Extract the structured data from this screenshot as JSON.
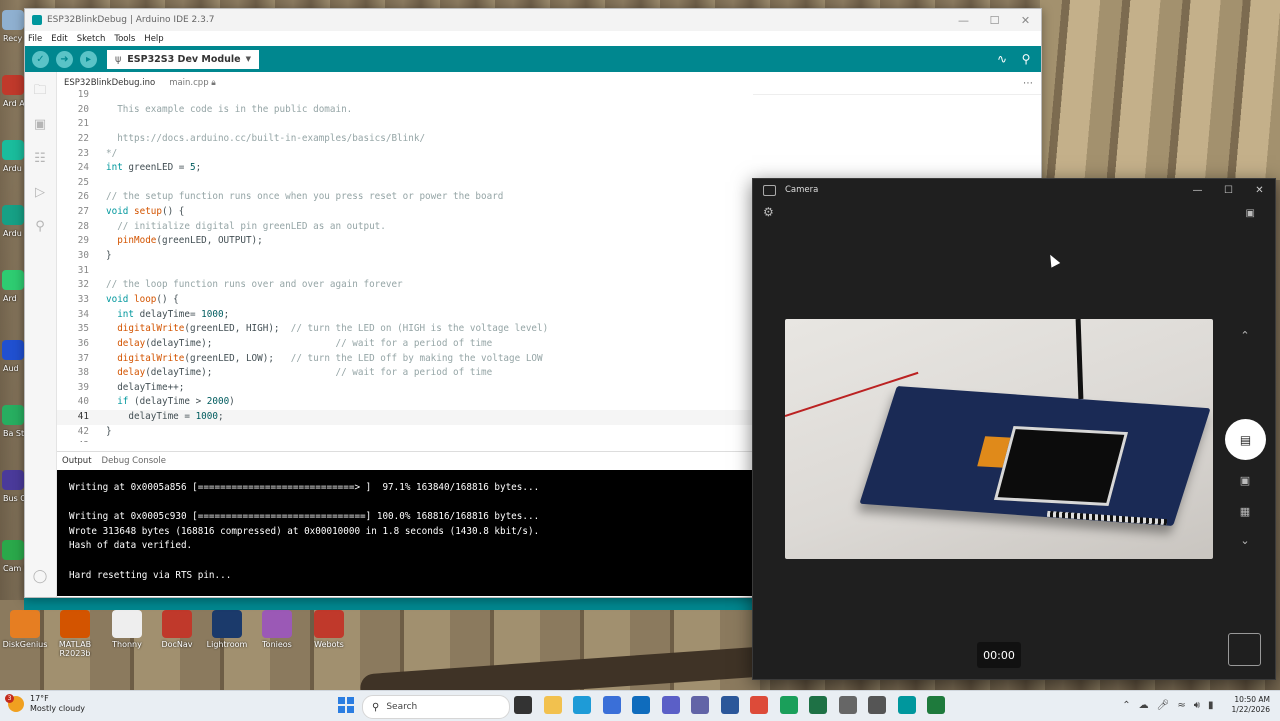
{
  "desktop": {
    "left_icons": [
      {
        "label": "Recy",
        "color": "#8fb0d0"
      },
      {
        "label": "Ard Ac",
        "color": "#c0392b"
      },
      {
        "label": "Ardu",
        "color": "#1abc9c"
      },
      {
        "label": "Ardu",
        "color": "#16a085"
      },
      {
        "label": "Ard",
        "color": "#2ecc71"
      },
      {
        "label": "Aud",
        "color": "#2050d0"
      },
      {
        "label": "Ba Stu",
        "color": "#27ae60"
      },
      {
        "label": "Bus Co",
        "color": "#4a3a9a"
      },
      {
        "label": "Cam Stu",
        "color": "#2aa84a"
      }
    ],
    "bottom_icons": [
      {
        "label": "DiskGenius",
        "color": "#e67e22"
      },
      {
        "label": "MATLAB R2023b",
        "color": "#d35400"
      },
      {
        "label": "Thonny",
        "color": "#eeeeee"
      },
      {
        "label": "DocNav",
        "color": "#c0392b"
      },
      {
        "label": "Lightroom",
        "color": "#1b3a6b"
      },
      {
        "label": "Tonieos",
        "color": "#9b59b6"
      },
      {
        "label": "Webots",
        "color": "#c0392b"
      }
    ]
  },
  "ide": {
    "title": "ESP32BlinkDebug | Arduino IDE 2.3.7",
    "menu": [
      "File",
      "Edit",
      "Sketch",
      "Tools",
      "Help"
    ],
    "board": "ESP32S3 Dev Module",
    "tabs": [
      {
        "label": "ESP32BlinkDebug.ino",
        "active": true
      },
      {
        "label": "main.cpp",
        "active": false
      }
    ],
    "code_lines": [
      {
        "n": "19",
        "parts": []
      },
      {
        "n": "20",
        "parts": [
          {
            "t": "  This example code is in the public domain.",
            "c": "c-comment"
          }
        ]
      },
      {
        "n": "21",
        "parts": []
      },
      {
        "n": "22",
        "parts": [
          {
            "t": "  https://docs.arduino.cc/built-in-examples/basics/Blink/",
            "c": "c-comment"
          }
        ]
      },
      {
        "n": "23",
        "parts": [
          {
            "t": "*/",
            "c": "c-comment"
          }
        ]
      },
      {
        "n": "24",
        "parts": [
          {
            "t": "int",
            "c": "c-kw"
          },
          {
            "t": " greenLED = ",
            "c": "c-plain"
          },
          {
            "t": "5",
            "c": "c-num"
          },
          {
            "t": ";",
            "c": "c-plain"
          }
        ]
      },
      {
        "n": "25",
        "parts": []
      },
      {
        "n": "26",
        "parts": [
          {
            "t": "// the setup function runs once when you press reset or power the board",
            "c": "c-comment"
          }
        ]
      },
      {
        "n": "27",
        "parts": [
          {
            "t": "void",
            "c": "c-kw"
          },
          {
            "t": " ",
            "c": "c-plain"
          },
          {
            "t": "setup",
            "c": "c-fn"
          },
          {
            "t": "() {",
            "c": "c-plain"
          }
        ]
      },
      {
        "n": "28",
        "parts": [
          {
            "t": "  // initialize digital pin greenLED as an output.",
            "c": "c-comment"
          }
        ]
      },
      {
        "n": "29",
        "parts": [
          {
            "t": "  ",
            "c": "c-plain"
          },
          {
            "t": "pinMode",
            "c": "c-fn"
          },
          {
            "t": "(greenLED, OUTPUT);",
            "c": "c-plain"
          }
        ]
      },
      {
        "n": "30",
        "parts": [
          {
            "t": "}",
            "c": "c-plain"
          }
        ]
      },
      {
        "n": "31",
        "parts": []
      },
      {
        "n": "32",
        "parts": [
          {
            "t": "// the loop function runs over and over again forever",
            "c": "c-comment"
          }
        ]
      },
      {
        "n": "33",
        "parts": [
          {
            "t": "void",
            "c": "c-kw"
          },
          {
            "t": " ",
            "c": "c-plain"
          },
          {
            "t": "loop",
            "c": "c-fn"
          },
          {
            "t": "() {",
            "c": "c-plain"
          }
        ]
      },
      {
        "n": "34",
        "parts": [
          {
            "t": "  ",
            "c": "c-plain"
          },
          {
            "t": "int",
            "c": "c-kw"
          },
          {
            "t": " delayTime= ",
            "c": "c-plain"
          },
          {
            "t": "1000",
            "c": "c-num"
          },
          {
            "t": ";",
            "c": "c-plain"
          }
        ]
      },
      {
        "n": "35",
        "parts": [
          {
            "t": "  ",
            "c": "c-plain"
          },
          {
            "t": "digitalWrite",
            "c": "c-fn"
          },
          {
            "t": "(greenLED, HIGH);  ",
            "c": "c-plain"
          },
          {
            "t": "// turn the LED on (HIGH is the voltage level)",
            "c": "c-comment"
          }
        ]
      },
      {
        "n": "36",
        "parts": [
          {
            "t": "  ",
            "c": "c-plain"
          },
          {
            "t": "delay",
            "c": "c-fn"
          },
          {
            "t": "(delayTime);                      ",
            "c": "c-plain"
          },
          {
            "t": "// wait for a period of time",
            "c": "c-comment"
          }
        ]
      },
      {
        "n": "37",
        "parts": [
          {
            "t": "  ",
            "c": "c-plain"
          },
          {
            "t": "digitalWrite",
            "c": "c-fn"
          },
          {
            "t": "(greenLED, LOW);   ",
            "c": "c-plain"
          },
          {
            "t": "// turn the LED off by making the voltage LOW",
            "c": "c-comment"
          }
        ]
      },
      {
        "n": "38",
        "parts": [
          {
            "t": "  ",
            "c": "c-plain"
          },
          {
            "t": "delay",
            "c": "c-fn"
          },
          {
            "t": "(delayTime);                      ",
            "c": "c-plain"
          },
          {
            "t": "// wait for a period of time",
            "c": "c-comment"
          }
        ]
      },
      {
        "n": "39",
        "parts": [
          {
            "t": "  delayTime++;",
            "c": "c-plain"
          }
        ]
      },
      {
        "n": "40",
        "parts": [
          {
            "t": "  ",
            "c": "c-plain"
          },
          {
            "t": "if",
            "c": "c-kw"
          },
          {
            "t": " (delayTime > ",
            "c": "c-plain"
          },
          {
            "t": "2000",
            "c": "c-num"
          },
          {
            "t": ")",
            "c": "c-plain"
          }
        ]
      },
      {
        "n": "41",
        "parts": [
          {
            "t": "    delayTime = ",
            "c": "c-plain"
          },
          {
            "t": "1000",
            "c": "c-num"
          },
          {
            "t": ";",
            "c": "c-plain"
          }
        ],
        "active": true
      },
      {
        "n": "42",
        "parts": [
          {
            "t": "}",
            "c": "c-plain"
          }
        ]
      },
      {
        "n": "43",
        "parts": []
      }
    ],
    "panel_tabs": [
      "Output",
      "Debug Console"
    ],
    "output_lines": [
      "Writing at 0x0005a856 [============================> ]  97.1% 163840/168816 bytes...",
      "",
      "Writing at 0x0005c930 [==============================] 100.0% 168816/168816 bytes...",
      "Wrote 313648 bytes (168816 compressed) at 0x00010000 in 1.8 seconds (1430.8 kbit/s).",
      "Hash of data verified.",
      "",
      "Hard resetting via RTS pin..."
    ]
  },
  "camera": {
    "title": "Camera",
    "timer": "00:00"
  },
  "taskbar": {
    "weather_temp": "17°F",
    "weather_desc": "Mostly cloudy",
    "weather_badge": "3",
    "search_label": "Search",
    "time": "10:50 AM",
    "date": "1/22/2026",
    "apps": [
      {
        "name": "task-view",
        "color": "#333333"
      },
      {
        "name": "file-explorer",
        "color": "#f2c14e"
      },
      {
        "name": "edge",
        "color": "#1e9bd7"
      },
      {
        "name": "store",
        "color": "#3a6fd8"
      },
      {
        "name": "outlook",
        "color": "#0f6cbd"
      },
      {
        "name": "teams-chat",
        "color": "#5b5fc7"
      },
      {
        "name": "teams",
        "color": "#6264a7"
      },
      {
        "name": "word",
        "color": "#2b579a"
      },
      {
        "name": "chrome",
        "color": "#dd4b39"
      },
      {
        "name": "chrome-dev",
        "color": "#1a9f5a"
      },
      {
        "name": "excel-like",
        "color": "#1e7145"
      },
      {
        "name": "settings",
        "color": "#666666"
      },
      {
        "name": "camera",
        "color": "#555555"
      },
      {
        "name": "arduino",
        "color": "#00979d"
      },
      {
        "name": "code-app",
        "color": "#1e7a3c"
      }
    ]
  }
}
